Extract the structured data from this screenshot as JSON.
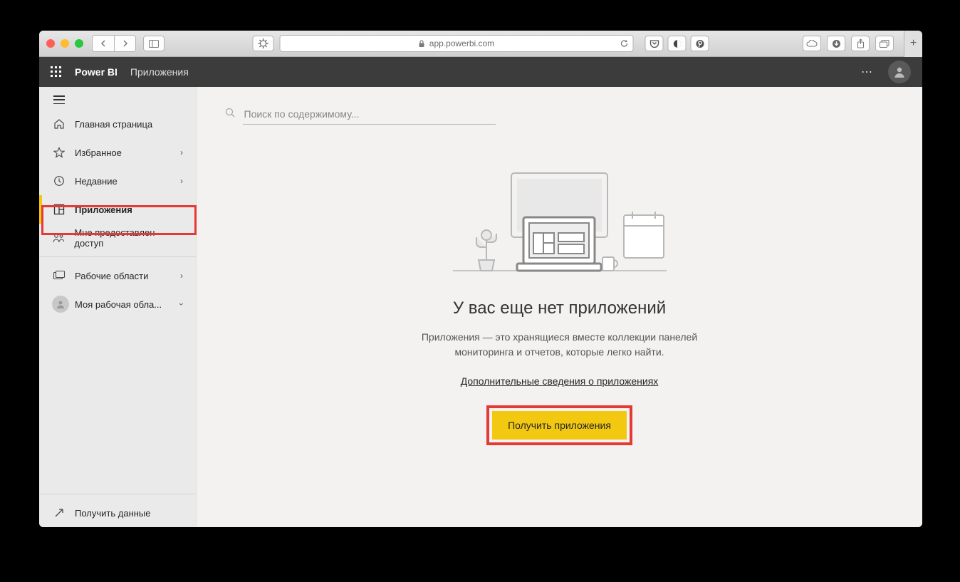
{
  "browser": {
    "url_display": "app.powerbi.com"
  },
  "header": {
    "brand": "Power BI",
    "section": "Приложения"
  },
  "sidebar": {
    "home": "Главная страница",
    "favorites": "Избранное",
    "recent": "Недавние",
    "apps": "Приложения",
    "shared": "Мне предоставлен доступ",
    "workspaces": "Рабочие области",
    "my_workspace": "Моя рабочая обла...",
    "get_data": "Получить данные"
  },
  "main": {
    "search_placeholder": "Поиск по содержимому...",
    "empty_title": "У вас еще нет приложений",
    "empty_desc": "Приложения — это хранящиеся вместе коллекции панелей мониторинга и отчетов, которые легко найти.",
    "learn_more": "Дополнительные сведения о приложениях",
    "get_apps": "Получить приложения"
  }
}
